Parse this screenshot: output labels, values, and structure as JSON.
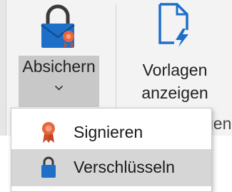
{
  "ribbon": {
    "secure_button": {
      "label": "Absichern",
      "icon": "envelope-lock-icon",
      "dropdown_icon": "chevron-down-icon"
    },
    "templates_button": {
      "label_line1": "Vorlagen",
      "label_line2": "anzeigen",
      "icon": "document-lightning-icon"
    },
    "partial_text_behind_menu": "gen"
  },
  "menu": {
    "items": [
      {
        "label": "Signieren",
        "icon": "ribbon-seal-icon",
        "highlighted": false
      },
      {
        "label": "Verschlüsseln",
        "icon": "lock-icon",
        "highlighted": true
      }
    ]
  },
  "colors": {
    "ribbon_bg": "#f3f3f3",
    "pressed_bg": "#c8c8c8",
    "hover_bg": "#d6d6d6",
    "icon_blue": "#1e6fc8",
    "seal_orange": "#e8643c"
  }
}
